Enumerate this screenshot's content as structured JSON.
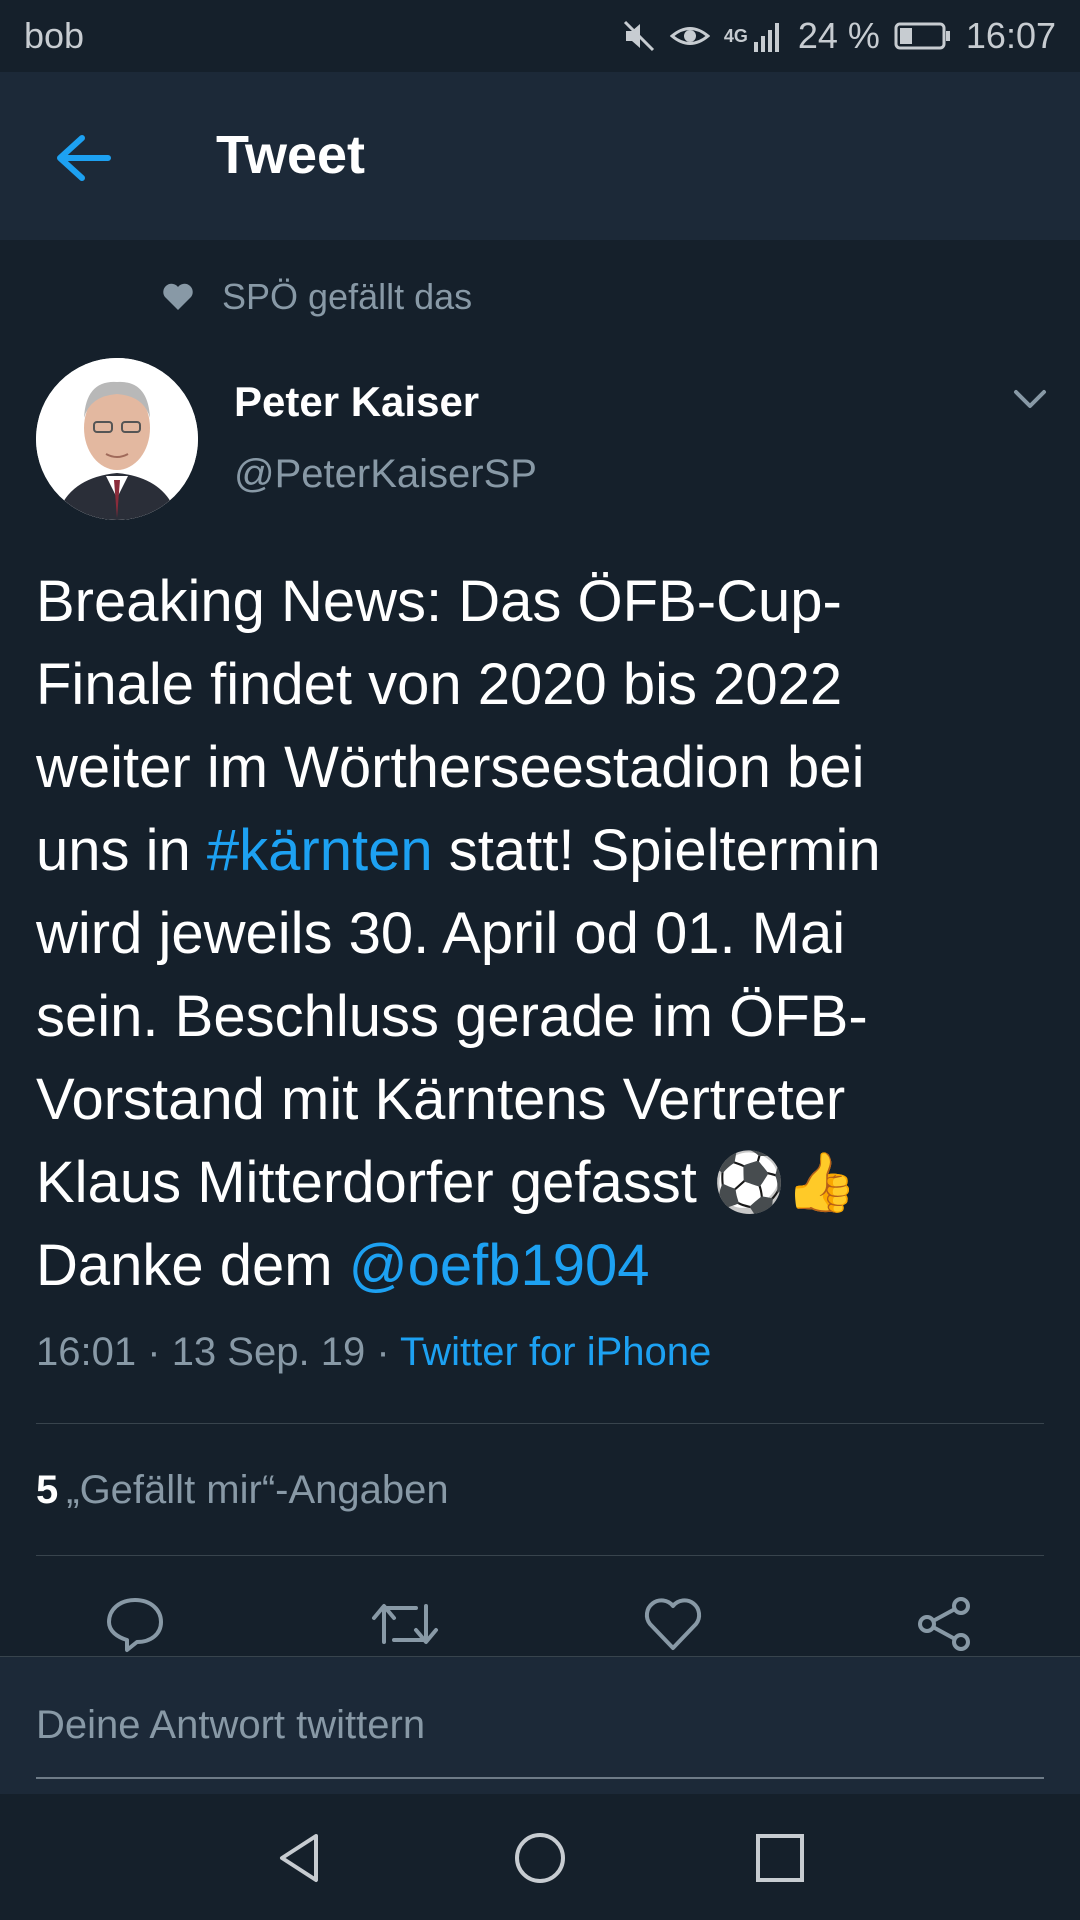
{
  "status_bar": {
    "carrier": "bob",
    "network": "4G",
    "battery": "24 %",
    "time": "16:07"
  },
  "header": {
    "back_icon": "arrow-left-icon",
    "title": "Tweet"
  },
  "social_context": {
    "icon": "heart-icon",
    "text": "SPÖ gefällt das"
  },
  "author": {
    "name": "Peter Kaiser",
    "handle": "@PeterKaiserSP"
  },
  "tweet": {
    "text_part1": "Breaking News: Das ÖFB-Cup-\nFinale findet von 2020 bis 2022\nweiter im Wörtherseestadion bei\nuns in ",
    "hashtag": "#kärnten",
    "text_part2": " statt! Spieltermin\nwird jeweils 30. April od 01. Mai\nsein. Beschluss gerade im ÖFB-\nVorstand mit Kärntens Vertreter\nKlaus Mitterdorfer gefasst ",
    "emoji": "⚽👍",
    "text_part3": "\nDanke dem ",
    "mention": "@oefb1904",
    "time": "16:01",
    "date": "13 Sep. 19",
    "separator": "·",
    "source": "Twitter for iPhone"
  },
  "likes": {
    "count": "5",
    "label": "„Gefällt mir“-Angaben"
  },
  "actions": [
    "reply-icon",
    "retweet-icon",
    "like-icon",
    "share-icon"
  ],
  "composer": {
    "placeholder": "Deine Antwort twittern"
  },
  "colors": {
    "background": "#15202b",
    "header": "#1c2938",
    "accent": "#1da1f2",
    "secondary_text": "#8899a6"
  }
}
